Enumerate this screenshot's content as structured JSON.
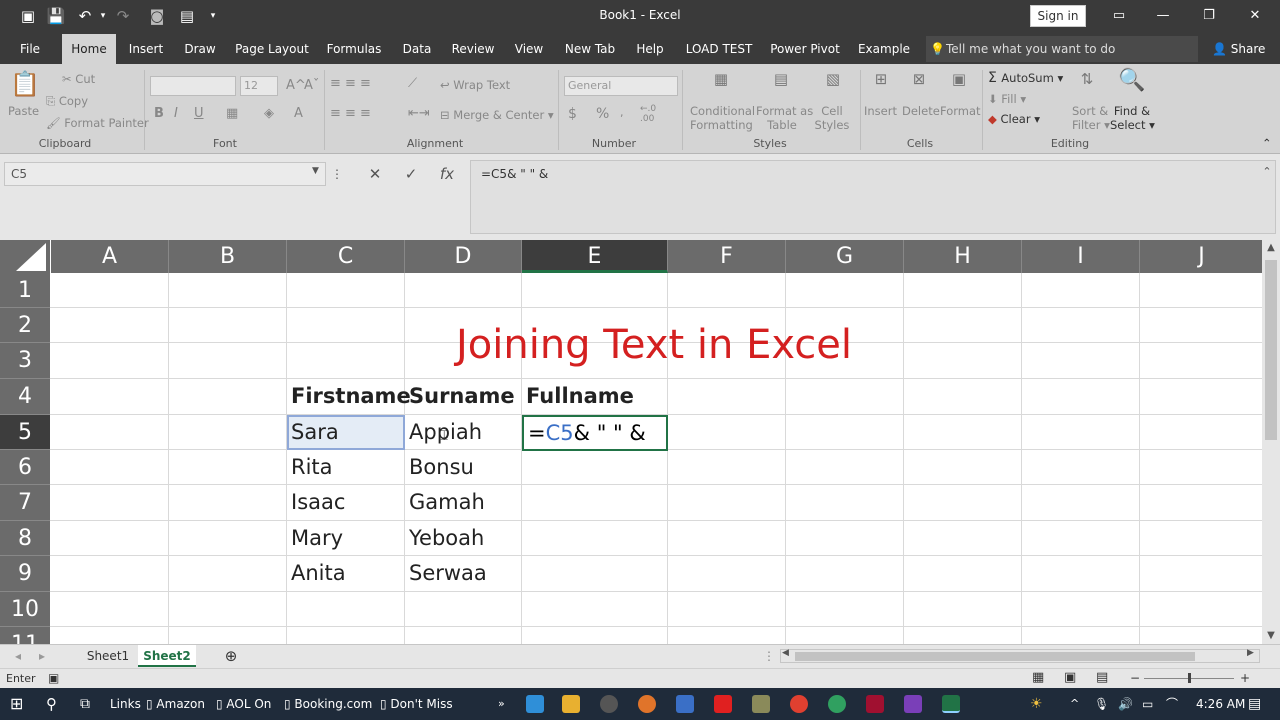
{
  "titlebar": {
    "title": "Book1  -  Excel",
    "sign_in": "Sign in"
  },
  "tabs": [
    "File",
    "Home",
    "Insert",
    "Draw",
    "Page Layout",
    "Formulas",
    "Data",
    "Review",
    "View",
    "New Tab",
    "Help",
    "LOAD TEST",
    "Power Pivot",
    "Example"
  ],
  "active_tab": "Home",
  "tell_me": "Tell me what you want to do",
  "share": "Share",
  "ribbon": {
    "clipboard": {
      "paste": "Paste",
      "cut": "Cut",
      "copy": "Copy",
      "format_painter": "Format Painter",
      "label": "Clipboard"
    },
    "font": {
      "font_size": "12",
      "bold": "B",
      "italic": "I",
      "underline": "U",
      "label": "Font"
    },
    "alignment": {
      "wrap_text": "Wrap Text",
      "merge_center": "Merge & Center",
      "label": "Alignment"
    },
    "number": {
      "format": "General",
      "currency": "$",
      "percent": "%",
      "label": "Number"
    },
    "styles": {
      "conditional": "Conditional",
      "formatting": "Formatting",
      "format_as": "Format as",
      "table": "Table",
      "cell": "Cell",
      "cell_styles": "Styles",
      "label": "Styles"
    },
    "cells": {
      "insert": "Insert",
      "delete": "Delete",
      "format": "Format",
      "label": "Cells"
    },
    "editing": {
      "autosum": "AutoSum",
      "fill": "Fill",
      "clear": "Clear",
      "sort": "Sort &",
      "filter": "Filter",
      "find": "Find &",
      "select": "Select",
      "label": "Editing"
    }
  },
  "formula_bar": {
    "name_box": "C5",
    "formula": "=C5& \" \" &"
  },
  "columns": [
    "A",
    "B",
    "C",
    "D",
    "E",
    "F",
    "G",
    "H",
    "I",
    "J"
  ],
  "selected_column": "E",
  "rows": [
    "1",
    "2",
    "3",
    "4",
    "5",
    "6",
    "7",
    "8",
    "9",
    "10",
    "11"
  ],
  "selected_row": "5",
  "sheet": {
    "title": "Joining Text in Excel",
    "headers": {
      "c": "Firstname",
      "d": "Surname",
      "e": "Fullname"
    },
    "data": [
      {
        "first": "Sara",
        "last": "Appiah"
      },
      {
        "first": "Rita",
        "last": "Bonsu"
      },
      {
        "first": "Isaac",
        "last": "Gamah"
      },
      {
        "first": "Mary",
        "last": "Yeboah"
      },
      {
        "first": "Anita",
        "last": "Serwaa"
      }
    ],
    "edit_cell": {
      "prefix": "=",
      "ref": "C5",
      "suffix": "& \" \" &"
    }
  },
  "sheet_tabs": [
    "Sheet1",
    "Sheet2"
  ],
  "active_sheet": "Sheet2",
  "status": "Enter",
  "taskbar": {
    "links": "Links",
    "bookmarks": [
      "Amazon",
      "AOL On",
      "Booking.com",
      "Don't Miss"
    ],
    "time": "4:26 AM"
  },
  "colors": {
    "accent": "#217346",
    "title_red": "#d42020",
    "ref_blue": "#3a6fc6"
  }
}
